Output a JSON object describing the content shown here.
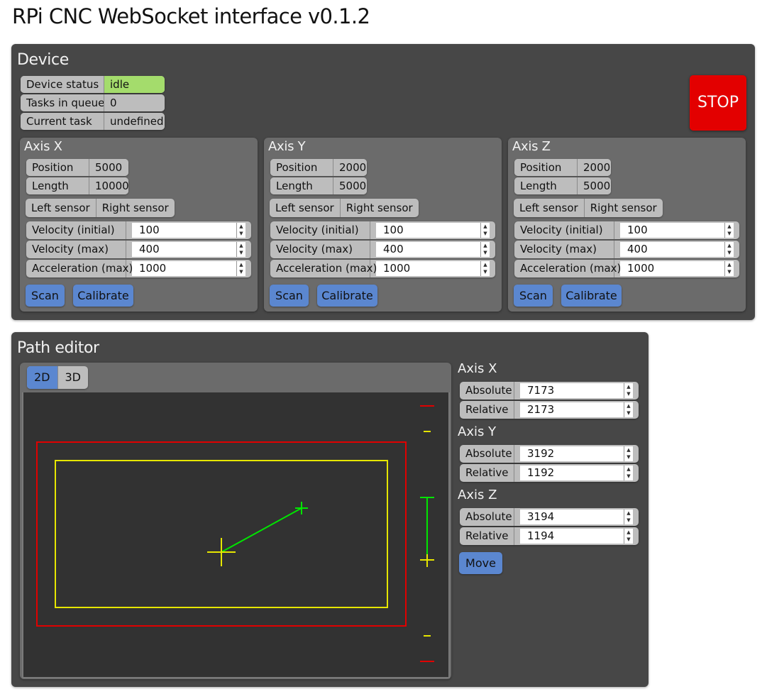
{
  "app": {
    "title": "RPi CNC WebSocket interface v0.1.2"
  },
  "device": {
    "title": "Device",
    "status": [
      {
        "label": "Device status",
        "value": "idle"
      },
      {
        "label": "Tasks in queue",
        "value": "0"
      },
      {
        "label": "Current task",
        "value": "undefined"
      }
    ],
    "stop_label": "STOP",
    "axes": [
      {
        "name": "Axis X",
        "position_label": "Position",
        "position": "5000",
        "length_label": "Length",
        "length": "10000",
        "left_sensor": "Left sensor",
        "right_sensor": "Right sensor",
        "velocity_initial_label": "Velocity (initial)",
        "velocity_initial": "100",
        "velocity_max_label": "Velocity (max)",
        "velocity_max": "400",
        "acceleration_max_label": "Acceleration (max)",
        "acceleration_max": "1000",
        "scan_label": "Scan",
        "calibrate_label": "Calibrate"
      },
      {
        "name": "Axis Y",
        "position_label": "Position",
        "position": "2000",
        "length_label": "Length",
        "length": "5000",
        "left_sensor": "Left sensor",
        "right_sensor": "Right sensor",
        "velocity_initial_label": "Velocity (initial)",
        "velocity_initial": "100",
        "velocity_max_label": "Velocity (max)",
        "velocity_max": "400",
        "acceleration_max_label": "Acceleration (max)",
        "acceleration_max": "1000",
        "scan_label": "Scan",
        "calibrate_label": "Calibrate"
      },
      {
        "name": "Axis Z",
        "position_label": "Position",
        "position": "2000",
        "length_label": "Length",
        "length": "5000",
        "left_sensor": "Left sensor",
        "right_sensor": "Right sensor",
        "velocity_initial_label": "Velocity (initial)",
        "velocity_initial": "100",
        "velocity_max_label": "Velocity (max)",
        "velocity_max": "400",
        "acceleration_max_label": "Acceleration (max)",
        "acceleration_max": "1000",
        "scan_label": "Scan",
        "calibrate_label": "Calibrate"
      }
    ]
  },
  "path_editor": {
    "title": "Path editor",
    "tabs": [
      {
        "label": "2D",
        "active": true
      },
      {
        "label": "3D",
        "active": false
      }
    ],
    "targets": [
      {
        "name": "Axis X",
        "absolute_label": "Absolute",
        "absolute": "7173",
        "relative_label": "Relative",
        "relative": "2173"
      },
      {
        "name": "Axis Y",
        "absolute_label": "Absolute",
        "absolute": "3192",
        "relative_label": "Relative",
        "relative": "1192"
      },
      {
        "name": "Axis Z",
        "absolute_label": "Absolute",
        "absolute": "3194",
        "relative_label": "Relative",
        "relative": "1194"
      }
    ],
    "move_label": "Move"
  },
  "colors": {
    "panel": "#474747",
    "subpanel": "#6b6b6b",
    "field": "#bdbdbd",
    "accent": "#5b87d0",
    "idle": "#a4dc6c",
    "stop": "#e30000",
    "limit": "#e00000",
    "range": "#e6e600",
    "path": "#00e600",
    "canvas": "#323232"
  }
}
